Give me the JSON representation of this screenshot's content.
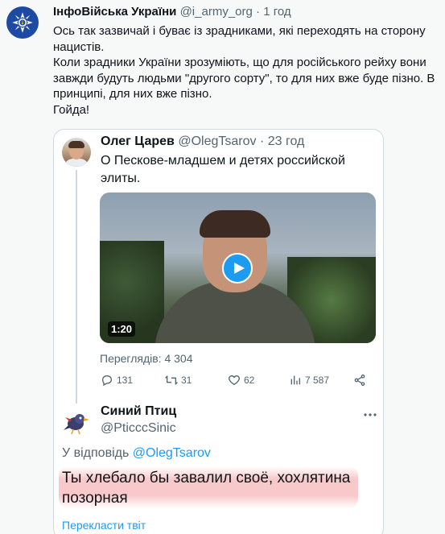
{
  "main_tweet": {
    "author_name": "ІнфоВійська України",
    "handle": "@i_army_org",
    "separator": "·",
    "time": "1 год",
    "text": "Ось так зазвичай і буває із зрадниками, які переходять на сторону нацистів.\nКоли зрадники України зрозуміють, що для російського рейху вони завжди будуть людьми \"другого сорту\", то для них вже буде пізно. В принципі, для них вже пізно.\nГойда!"
  },
  "quoted_tweet": {
    "author_name": "Олег Царев",
    "handle": "@OlegTsarov",
    "separator": "·",
    "time": "23 год",
    "text": "О Пескове-младшем и детях российской элиты.",
    "video_duration": "1:20",
    "views": "Переглядів: 4 304",
    "actions": {
      "replies": "131",
      "retweets": "31",
      "likes": "62",
      "views": "7 587"
    }
  },
  "reply_tweet": {
    "author_name": "Синий Птиц",
    "handle": "@PticccSinic",
    "reply_label": "У відповідь",
    "reply_mention": "@OlegTsarov",
    "text": "Ты хлебало бы завалил своё, хохлятина позорная",
    "translate_label": "Перекласти твіт"
  },
  "colors": {
    "accent": "#1d9bf0",
    "secondary_text": "#536471",
    "primary_text": "#0f1419",
    "highlight": "#f6b7ba",
    "avatar_blue": "#1d4aa3"
  },
  "icons": [
    "army-emblem-icon",
    "play-icon",
    "reply-icon",
    "retweet-icon",
    "like-icon",
    "views-chart-icon",
    "share-icon",
    "more-icon"
  ]
}
